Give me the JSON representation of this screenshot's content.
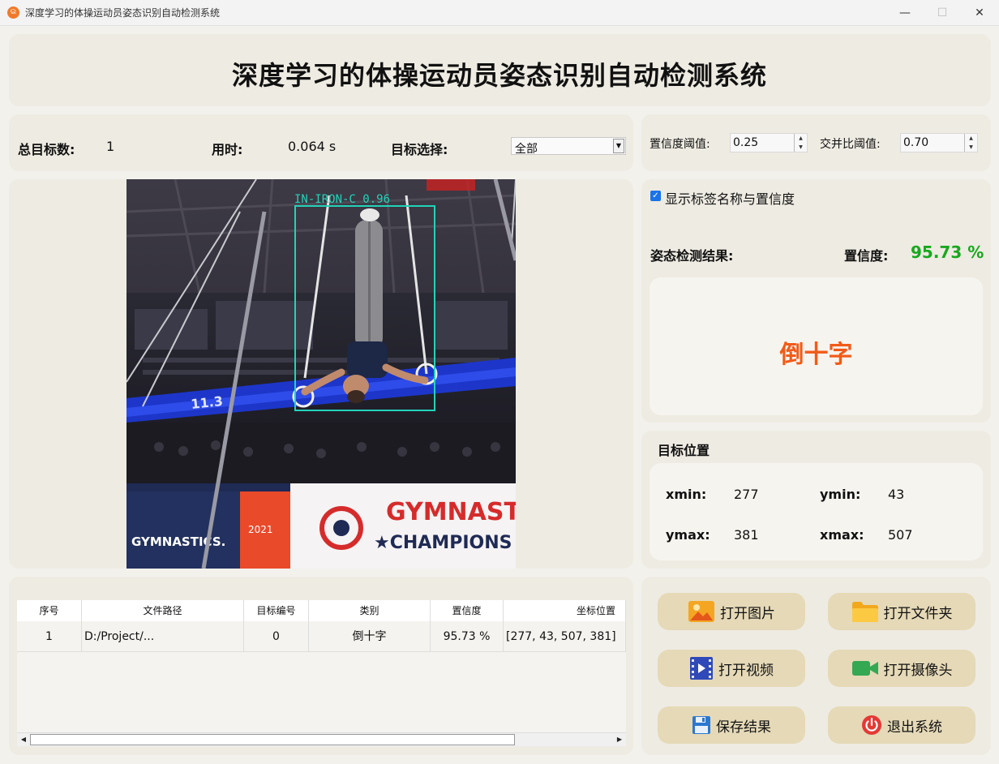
{
  "window": {
    "title": "深度学习的体操运动员姿态识别自动检测系统",
    "icon_glyph": "ଇ",
    "minimize_glyph": "—",
    "maximize_glyph": "☐",
    "close_glyph": "✕"
  },
  "header": {
    "title": "深度学习的体操运动员姿态识别自动检测系统"
  },
  "stats": {
    "total_label": "总目标数:",
    "total_value": "1",
    "time_label": "用时:",
    "time_value": "0.064 s",
    "target_select_label": "目标选择:",
    "target_select_value": "全部",
    "dropdown_glyph": "▼"
  },
  "thresholds": {
    "conf_label": "置信度阈值:",
    "conf_value": "0.25",
    "iou_label": "交并比阈值:",
    "iou_value": "0.70",
    "spin_up": "▲",
    "spin_down": "▼"
  },
  "options": {
    "show_labels_text": "显示标签名称与置信度",
    "show_labels_checked": true,
    "check_glyph": "✓"
  },
  "result": {
    "pose_label": "姿态检测结果:",
    "confidence_label": "置信度:",
    "confidence_value": "95.73 %",
    "confidence_color": "#18a81e",
    "class_name": "倒十字",
    "class_color": "#f25a18"
  },
  "detection_image": {
    "box_label": "IN-IRON-C 0.96",
    "box_color": "#22d3b8",
    "banner_left": "GYMNASTICS.",
    "banner_year": "2021",
    "banner_right_top": "GYMNAST",
    "banner_right_bottom": "★CHAMPIONS",
    "scoreboard": "11.3"
  },
  "position": {
    "title": "目标位置",
    "xmin_label": "xmin:",
    "xmin_value": "277",
    "ymin_label": "ymin:",
    "ymin_value": "43",
    "ymax_label": "ymax:",
    "ymax_value": "381",
    "xmax_label": "xmax:",
    "xmax_value": "507"
  },
  "table": {
    "headers": [
      "序号",
      "文件路径",
      "目标编号",
      "类别",
      "置信度",
      "坐标位置"
    ],
    "rows": [
      [
        "1",
        "D:/Project/...",
        "0",
        "倒十字",
        "95.73 %",
        "[277, 43, 507, 381]"
      ]
    ],
    "scroll_left_glyph": "◀",
    "scroll_right_glyph": "▶"
  },
  "buttons": {
    "open_image": "打开图片",
    "open_folder": "打开文件夹",
    "open_video": "打开视频",
    "open_camera": "打开摄像头",
    "save_result": "保存结果",
    "exit_system": "退出系统"
  }
}
